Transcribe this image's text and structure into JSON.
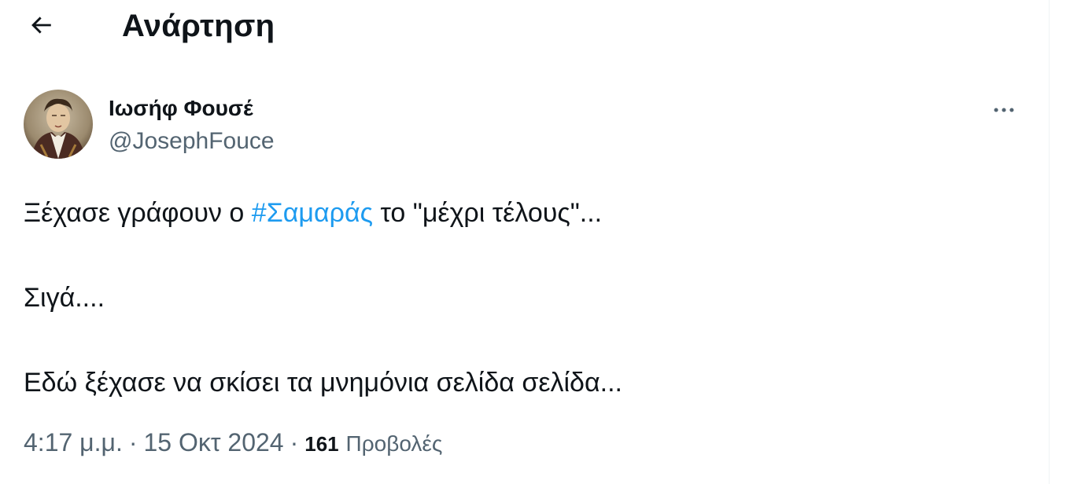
{
  "header": {
    "title": "Ανάρτηση",
    "back_icon": "arrow-left-icon"
  },
  "post": {
    "author": {
      "display_name": "Ιωσήφ Φουσέ",
      "handle": "@JosephFouce",
      "avatar_icon": "portrait-avatar"
    },
    "more_icon": "more-horizontal-icon",
    "text": {
      "line1_before": "Ξέχασε γράφουν ο ",
      "hashtag": "#Σαμαράς",
      "line1_after": " το \"μέχρι τέλους\"...",
      "line2": "Σιγά....",
      "line3": "Εδώ ξέχασε να σκίσει τα μνημόνια σελίδα σελίδα..."
    },
    "meta": {
      "time": "4:17 μ.μ.",
      "date": "15 Οκτ 2024",
      "views_count": "161",
      "views_label": "Προβολές",
      "separator": "·"
    }
  },
  "colors": {
    "accent": "#1d9bf0",
    "text_primary": "#0f1419",
    "text_secondary": "#536471",
    "border": "#eff3f4"
  }
}
